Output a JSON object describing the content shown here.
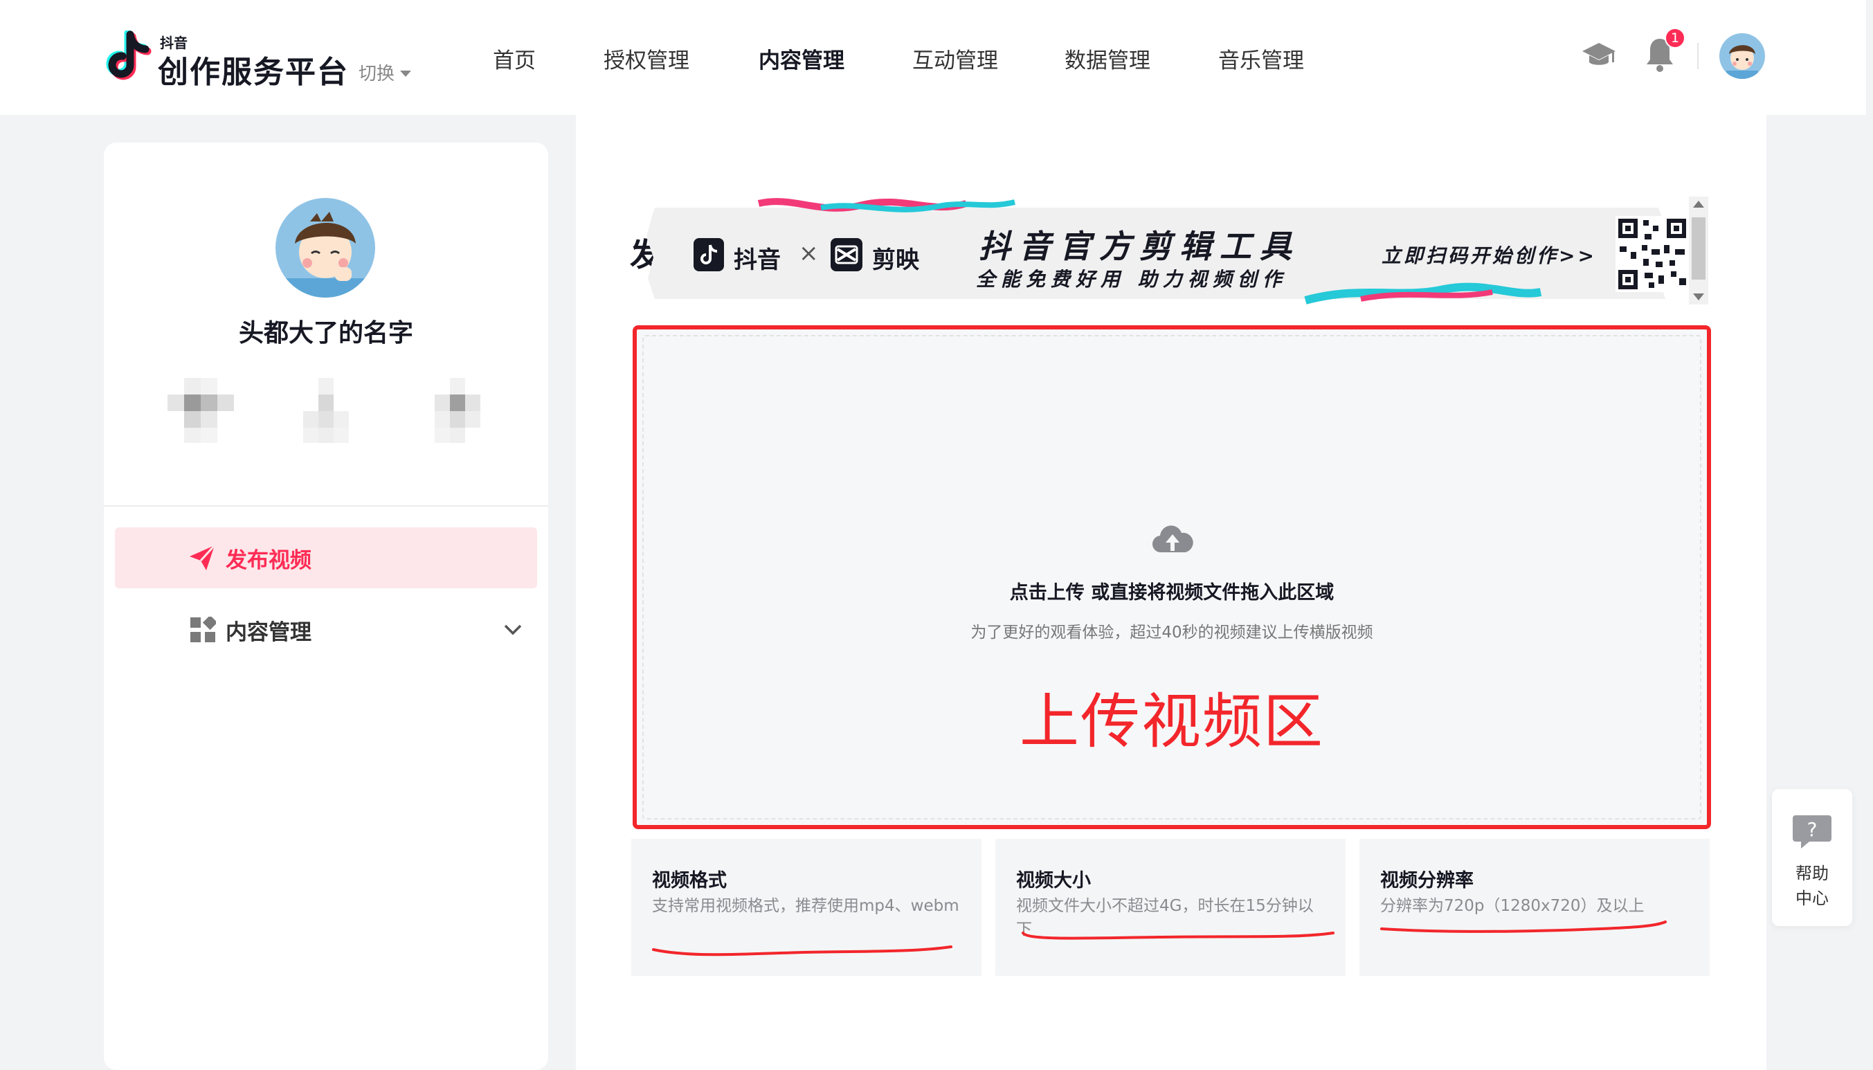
{
  "header": {
    "logo_small": "抖音",
    "logo_title": "创作服务平台",
    "switch_label": "切换",
    "nav": [
      {
        "label": "首页",
        "active": false
      },
      {
        "label": "授权管理",
        "active": false
      },
      {
        "label": "内容管理",
        "active": true
      },
      {
        "label": "互动管理",
        "active": false
      },
      {
        "label": "数据管理",
        "active": false
      },
      {
        "label": "音乐管理",
        "active": false
      }
    ],
    "notification_count": "1",
    "icons": [
      "graduation-cap-icon",
      "bell-icon",
      "avatar"
    ]
  },
  "sidebar": {
    "user_name": "头都大了的名字",
    "menu": [
      {
        "label": "发布视频",
        "icon": "send-icon",
        "active": true
      },
      {
        "label": "内容管理",
        "icon": "grid-icon",
        "active": false,
        "expandable": true
      }
    ]
  },
  "main": {
    "page_title": "发布视频",
    "banner": {
      "brand_a": "抖音",
      "cross": "×",
      "brand_b": "剪映",
      "headline": "抖音官方剪辑工具",
      "subline": "全能免费好用 助力视频创作",
      "cta": "立即扫码开始创作>>"
    },
    "uploader": {
      "title": "点击上传 或直接将视频文件拖入此区域",
      "tip": "为了更好的观看体验，超过40秒的视频建议上传横版视频",
      "annotation": "上传视频区"
    },
    "info_cards": [
      {
        "title": "视频格式",
        "desc": "支持常用视频格式，推荐使用mp4、webm"
      },
      {
        "title": "视频大小",
        "desc": "视频文件大小不超过4G，时长在15分钟以下"
      },
      {
        "title": "视频分辨率",
        "desc": "分辨率为720p（1280x720）及以上"
      }
    ]
  },
  "help": {
    "label": "帮助中心"
  },
  "colors": {
    "brand_red": "#fe2c55",
    "annotation_red": "#f2262b"
  }
}
